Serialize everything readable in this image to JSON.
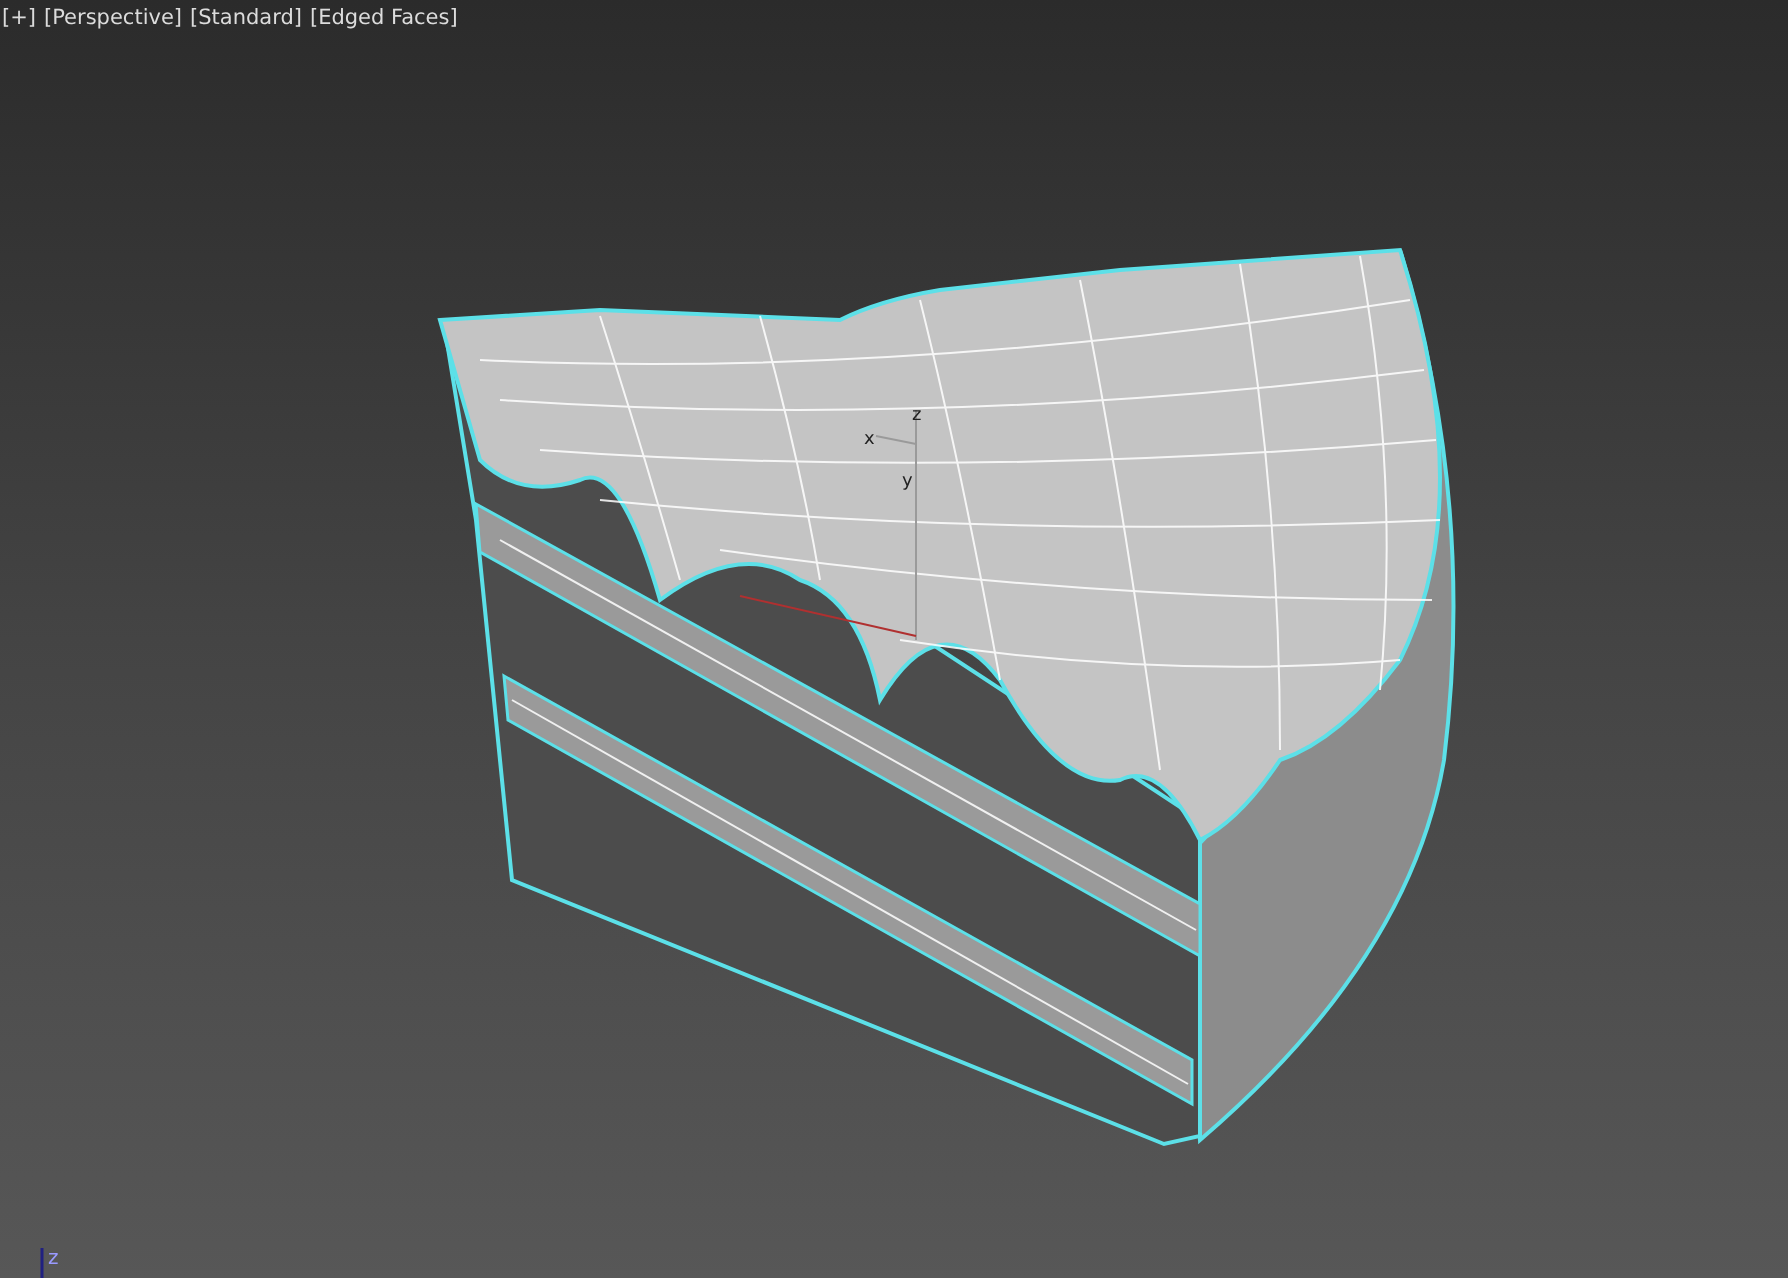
{
  "viewport_labels": [
    {
      "label": "[+]"
    },
    {
      "label": "[Perspective]"
    },
    {
      "label": "[Standard]"
    },
    {
      "label": "[Edged Faces]"
    }
  ],
  "pivot_gizmo": {
    "x_axis": "x",
    "y_axis": "y",
    "z_axis": "z"
  },
  "world_axis": {
    "z_axis": "z"
  }
}
